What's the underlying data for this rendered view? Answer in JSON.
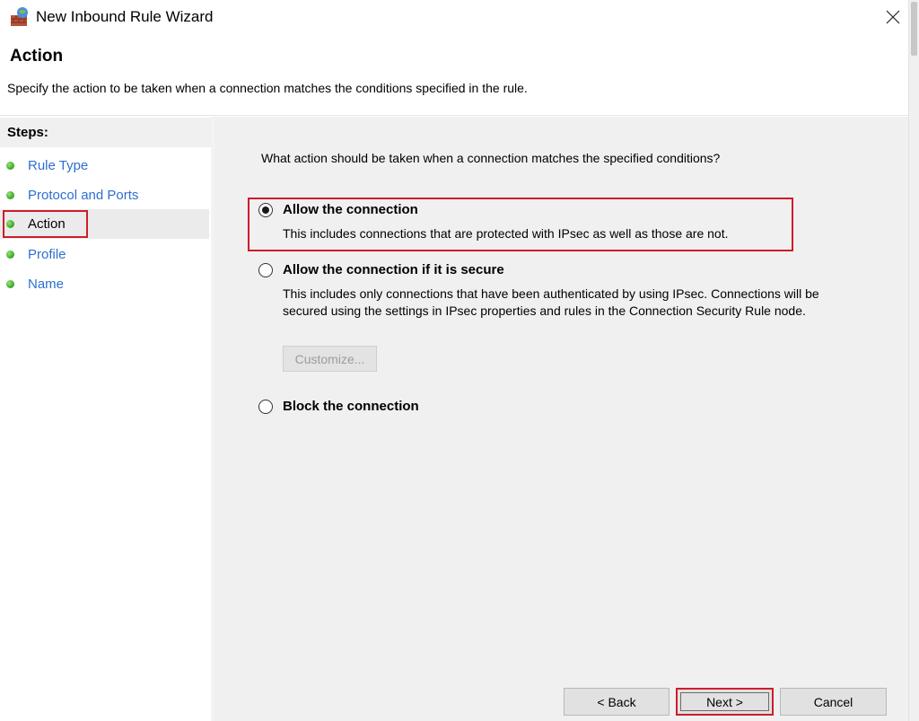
{
  "window": {
    "title": "New Inbound Rule Wizard",
    "icon": "firewall-wall-icon",
    "close_icon": "close-icon"
  },
  "header": {
    "title": "Action",
    "description": "Specify the action to be taken when a connection matches the conditions specified in the rule."
  },
  "steps": {
    "label": "Steps:",
    "items": [
      {
        "label": "Rule Type",
        "active": false
      },
      {
        "label": "Protocol and Ports",
        "active": false
      },
      {
        "label": "Action",
        "active": true
      },
      {
        "label": "Profile",
        "active": false
      },
      {
        "label": "Name",
        "active": false
      }
    ]
  },
  "content": {
    "question": "What action should be taken when a connection matches the specified conditions?",
    "options": [
      {
        "title": "Allow the connection",
        "description": "This includes connections that are protected with IPsec as well as those are not.",
        "selected": true
      },
      {
        "title": "Allow the connection if it is secure",
        "description": "This includes only connections that have been authenticated by using IPsec.  Connections will be secured using the settings in IPsec properties and rules in the Connection Security Rule node.",
        "selected": false
      },
      {
        "title": "Block the connection",
        "selected": false
      }
    ],
    "customize_label": "Customize..."
  },
  "buttons": {
    "back": "< Back",
    "next": "Next >",
    "cancel": "Cancel"
  },
  "colors": {
    "highlight": "#cc1e2a",
    "step_link": "#2e6fd1",
    "step_dot": "#3fae2a"
  }
}
